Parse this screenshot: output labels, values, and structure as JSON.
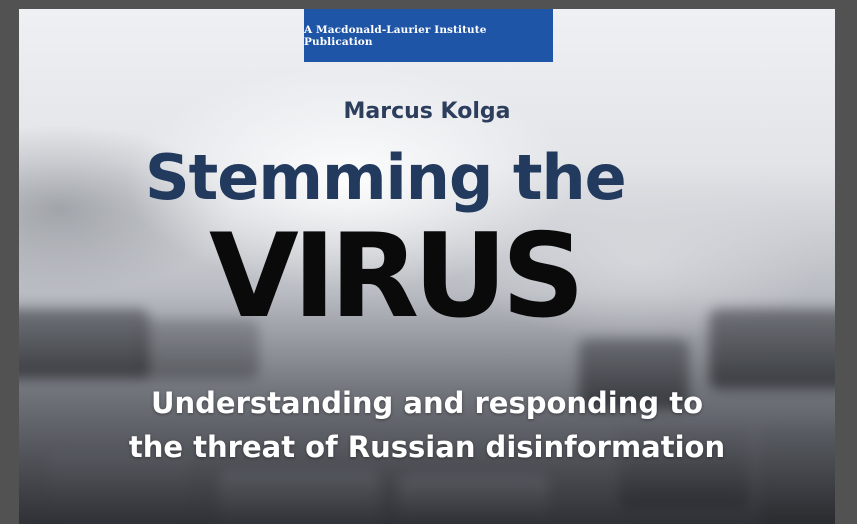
{
  "publication": {
    "banner": "A Macdonald-Laurier Institute Publication"
  },
  "cover": {
    "author": "Marcus Kolga",
    "title_line1": "Stemming the",
    "title_line2": "VIRUS",
    "subtitle_line1": "Understanding and responding to",
    "subtitle_line2": "the threat of Russian disinformation"
  },
  "colors": {
    "banner_blue": "#1f55a6",
    "title_navy": "#223a5e",
    "title_black": "#0a0a0a",
    "subtitle_white": "#ffffff"
  }
}
